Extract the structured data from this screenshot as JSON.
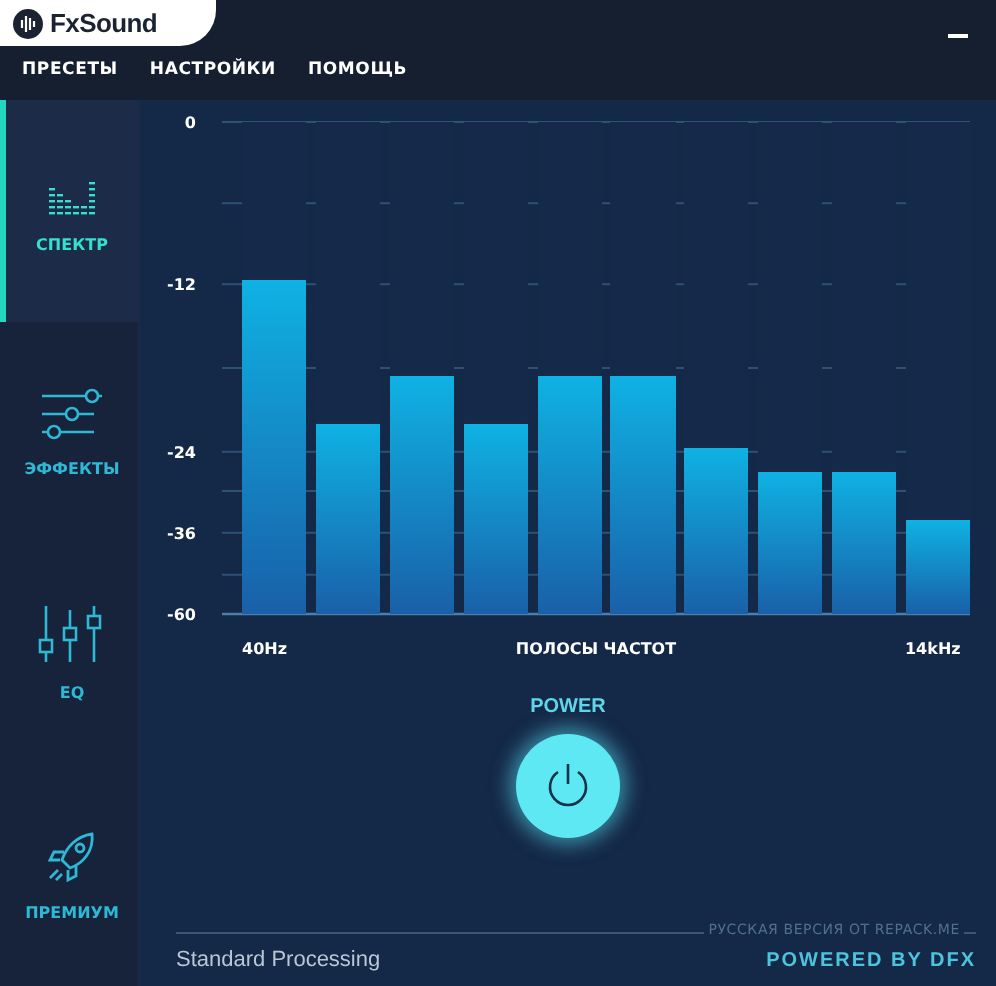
{
  "window": {
    "title": "FxSound"
  },
  "menu": [
    {
      "label": "ПРЕСЕТЫ"
    },
    {
      "label": "НАСТРОЙКИ"
    },
    {
      "label": "ПОМОЩЬ"
    }
  ],
  "sidebar": {
    "items": [
      {
        "kind": "spectrum",
        "label": "СПЕКТР",
        "selected": true
      },
      {
        "kind": "effects",
        "label": "ЭФФЕКТЫ",
        "selected": false
      },
      {
        "kind": "eq",
        "label": "EQ",
        "selected": false
      },
      {
        "kind": "premium",
        "label": "ПРЕМИУМ",
        "selected": false
      }
    ]
  },
  "spectrum": {
    "scale_labels": [
      "0",
      "-12",
      "-24",
      "-36",
      "-60"
    ],
    "start_label": "40Hz",
    "axis_title": "ПОЛОСЫ ЧАСТОТ",
    "end_label": "14kHz",
    "bands": [
      {
        "level": 0.68
      },
      {
        "level": 0.386
      },
      {
        "level": 0.484
      },
      {
        "level": 0.386
      },
      {
        "level": 0.484
      },
      {
        "level": 0.484
      },
      {
        "level": 0.337
      },
      {
        "level": 0.289
      },
      {
        "level": 0.289
      },
      {
        "level": 0.191
      }
    ]
  },
  "power": {
    "label": "POWER",
    "on": true
  },
  "credit": "РУССКАЯ ВЕРСИЯ ОТ REPACK.ME",
  "status_bar": {
    "preset": "Standard Processing",
    "brand": "POWERED BY DFX"
  }
}
